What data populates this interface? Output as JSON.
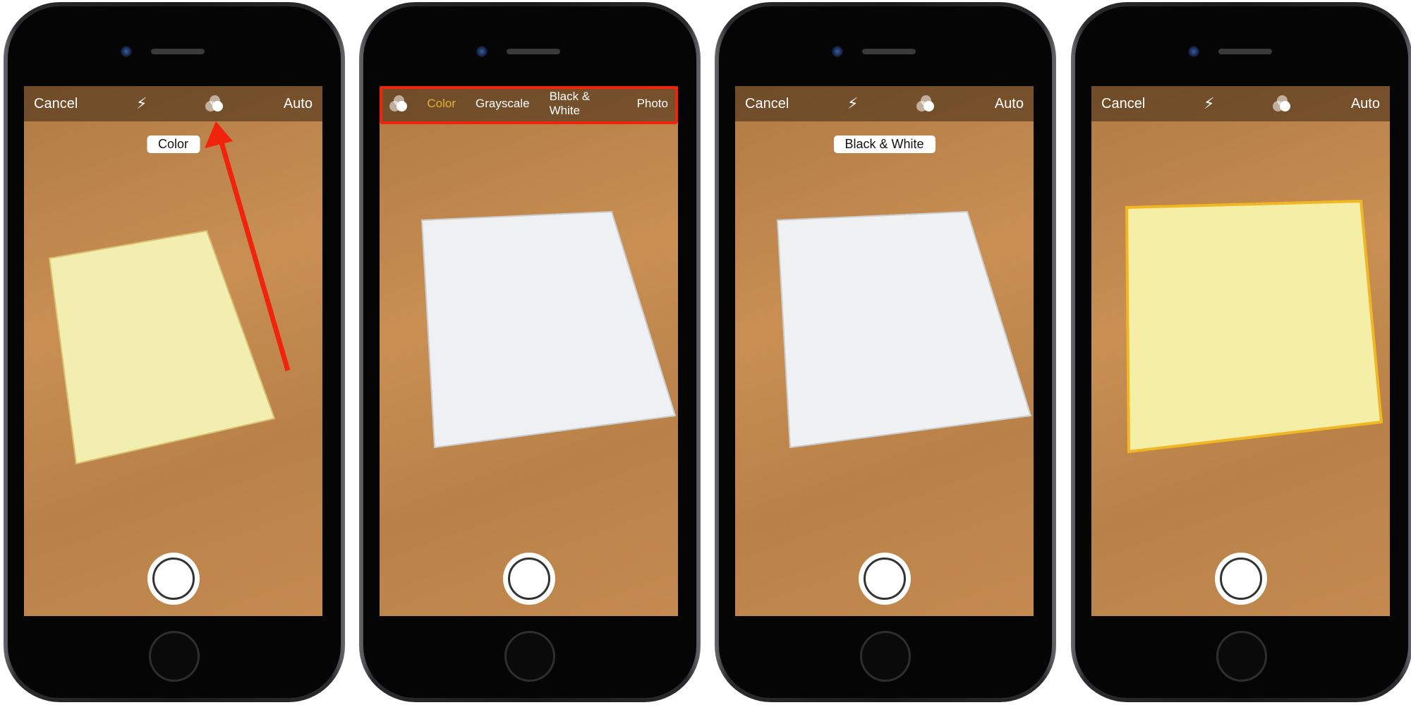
{
  "phones": [
    {
      "cancel": "Cancel",
      "auto": "Auto",
      "mode_pill": "Color",
      "paper_tint": "#f2eeb0"
    },
    {
      "filter_options": [
        "Color",
        "Grayscale",
        "Black & White",
        "Photo"
      ],
      "selected": "Color",
      "selected_color": "#e2b43a",
      "paper_tint": "#eef0f4"
    },
    {
      "cancel": "Cancel",
      "auto": "Auto",
      "mode_pill": "Black & White",
      "paper_tint": "#f0f1f3"
    },
    {
      "cancel": "Cancel",
      "auto": "Auto",
      "paper_tint": "#f5eea6",
      "detection_color": "#f0b624"
    }
  ],
  "annotation_color": "#f0240c",
  "icons": [
    "flash-icon",
    "filter-icon",
    "shutter-icon",
    "home-button"
  ]
}
